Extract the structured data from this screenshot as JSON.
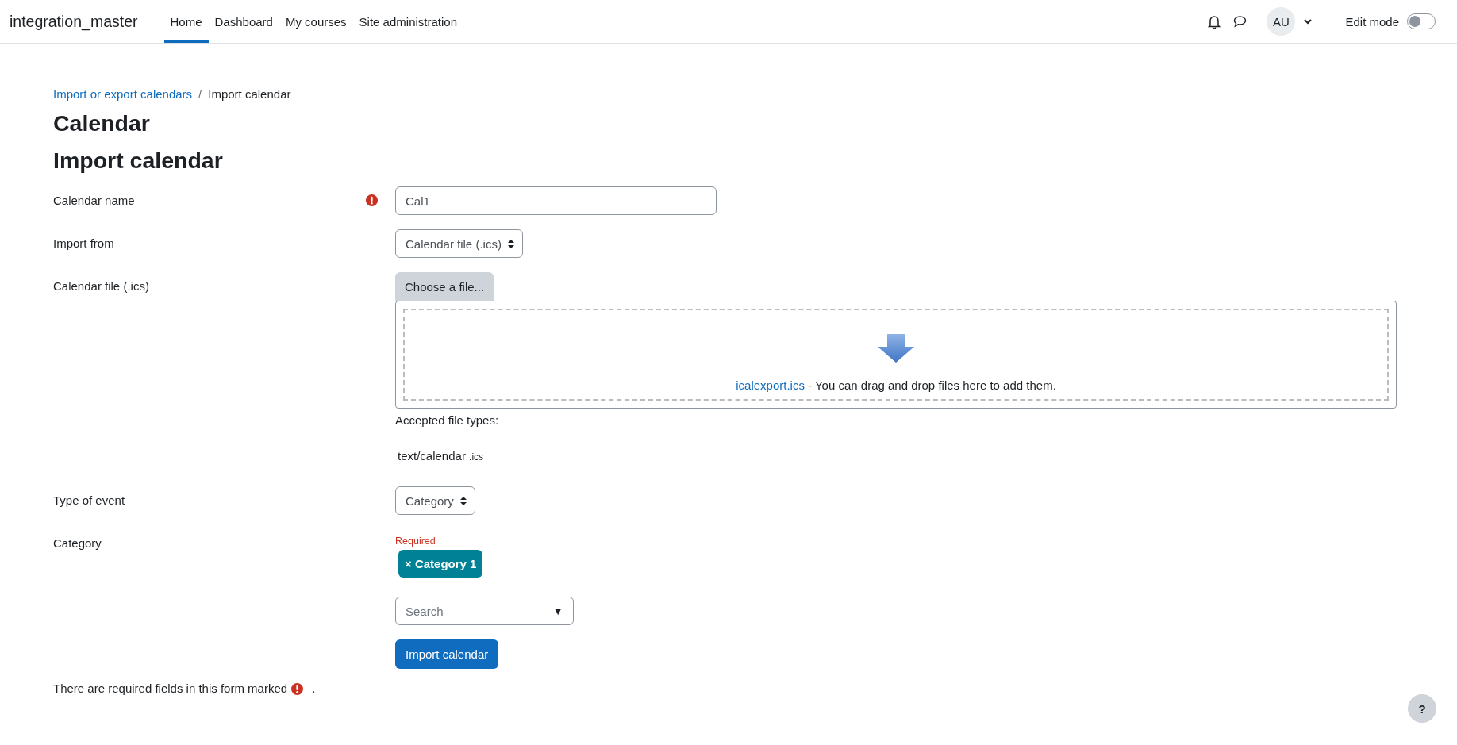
{
  "navbar": {
    "site_name": "integration_master",
    "nav_items": [
      {
        "label": "Home",
        "selected": true
      },
      {
        "label": "Dashboard",
        "selected": false
      },
      {
        "label": "My courses",
        "selected": false
      },
      {
        "label": "Site administration",
        "selected": false
      }
    ],
    "avatar": "AU",
    "edit_mode": {
      "label": "Edit mode",
      "on": false
    }
  },
  "breadcrumb_separator": "/",
  "breadcrumb": [
    {
      "label": "Import or export calendars",
      "kind": "link"
    },
    {
      "label": "Import calendar",
      "kind": "current"
    }
  ],
  "page_title": "Calendar",
  "heading": "Import calendar",
  "form": {
    "rows": [
      {
        "label": "Calendar name",
        "required": true,
        "kind": "text",
        "value": "Cal1"
      },
      {
        "label": "Import from",
        "required": false,
        "kind": "select",
        "value": "Calendar file (.ics)"
      },
      {
        "label": "Calendar file (.ics)",
        "required": false,
        "kind": "file",
        "button": "Choose a file...",
        "file_link": "icalexport.ics",
        "drop_text": "- You can drag and drop files here to add them.",
        "accepted_label": "Accepted file types:",
        "accepted_types": [
          {
            "mime": "text/calendar",
            "ext": ".ics"
          }
        ]
      },
      {
        "label": "Type of event",
        "required": false,
        "kind": "select",
        "value": "Category"
      },
      {
        "label": "Category",
        "required": false,
        "kind": "autocomplete",
        "error": "Required",
        "chips": [
          {
            "label": "× Category 1"
          }
        ],
        "placeholder": "Search",
        "toggle": "▼"
      }
    ],
    "submit": "Import calendar"
  },
  "footer_note": {
    "text": "There are required fields in this form marked",
    "end": "."
  },
  "help": "?"
}
